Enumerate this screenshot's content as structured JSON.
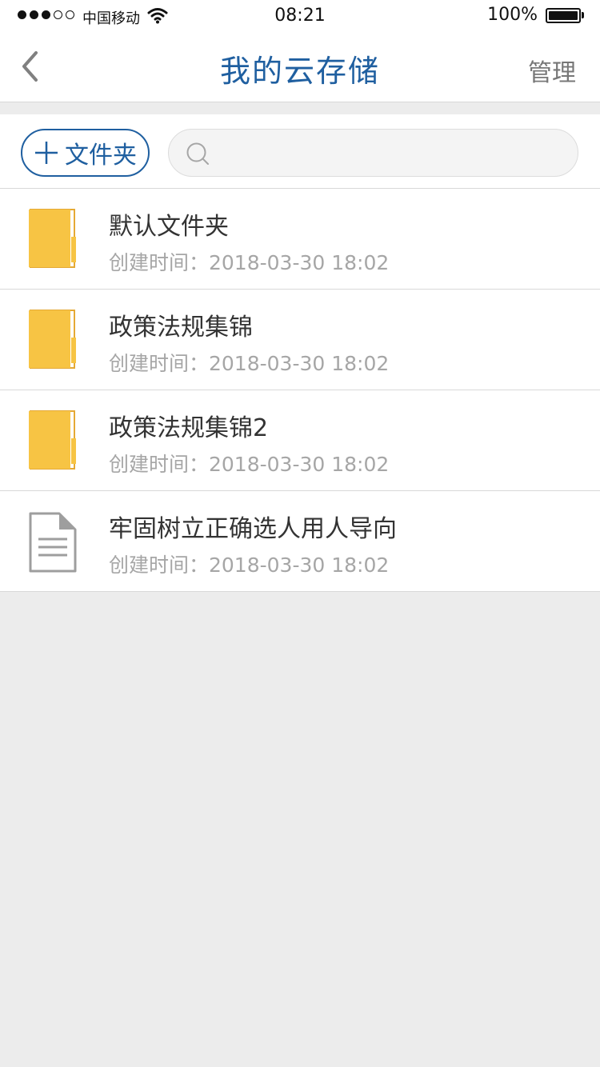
{
  "status_bar": {
    "signal_filled": 3,
    "signal_total": 5,
    "carrier": "中国移动",
    "time": "08:21",
    "battery": "100%"
  },
  "nav": {
    "back_icon": "chevron-left-icon",
    "title": "我的云存储",
    "manage_label": "管理"
  },
  "toolbar": {
    "add_folder_label": "文件夹",
    "search_placeholder": "",
    "search_value": ""
  },
  "colors": {
    "accent": "#1f5fa0",
    "folder": "#f7c444",
    "folder_dark": "#e5a935",
    "doc_icon": "#9e9e9e"
  },
  "items": [
    {
      "type": "folder",
      "icon": "folder-icon",
      "name": "默认文件夹",
      "time": "创建时间：2018-03-30 18:02"
    },
    {
      "type": "folder",
      "icon": "folder-icon",
      "name": "政策法规集锦",
      "time": "创建时间：2018-03-30 18:02"
    },
    {
      "type": "folder",
      "icon": "folder-icon",
      "name": "政策法规集锦2",
      "time": "创建时间：2018-03-30 18:02"
    },
    {
      "type": "document",
      "icon": "document-icon",
      "name": "牢固树立正确选人用人导向",
      "time": "创建时间：2018-03-30 18:02"
    }
  ]
}
